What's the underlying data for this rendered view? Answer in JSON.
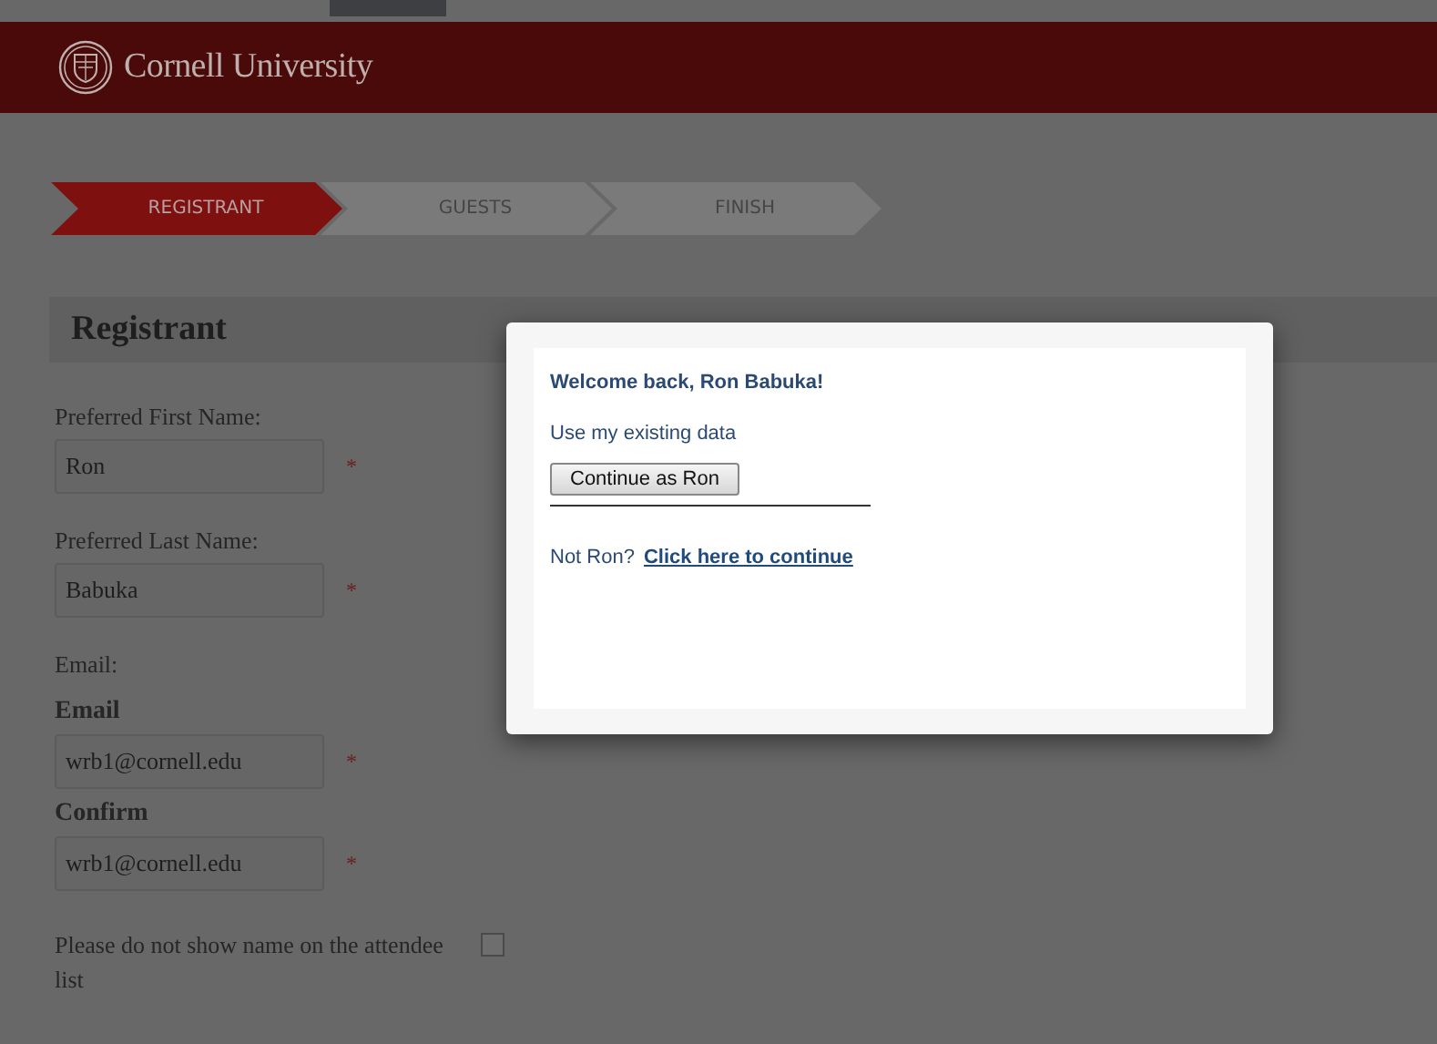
{
  "header": {
    "title": "Cornell University"
  },
  "steps": [
    {
      "label": "REGISTRANT",
      "selected": true
    },
    {
      "label": "GUESTS",
      "selected": false
    },
    {
      "label": "FINISH",
      "selected": false
    }
  ],
  "section": {
    "title": "Registrant"
  },
  "form": [
    {
      "kind": "field",
      "label": "Preferred First Name:",
      "bold": false,
      "value": "Ron",
      "mark": "*"
    },
    {
      "kind": "field",
      "label": "Preferred Last Name:",
      "bold": false,
      "value": "Babuka",
      "mark": "*"
    },
    {
      "kind": "heading",
      "label": "Email:"
    },
    {
      "kind": "field",
      "label": "Email",
      "bold": true,
      "value": "wrb1@cornell.edu",
      "mark": "*"
    },
    {
      "kind": "field",
      "label": "Confirm",
      "bold": true,
      "value": "wrb1@cornell.edu",
      "mark": "*"
    },
    {
      "kind": "checkbox",
      "label": "Please do not show name on the attendee list",
      "checked": false
    }
  ],
  "dialog": {
    "title": "Welcome back, Ron Babuka!",
    "subtitle": "Use my existing data",
    "button": "Continue as Ron",
    "prompt": "Not Ron?",
    "link": "Click here to continue"
  }
}
